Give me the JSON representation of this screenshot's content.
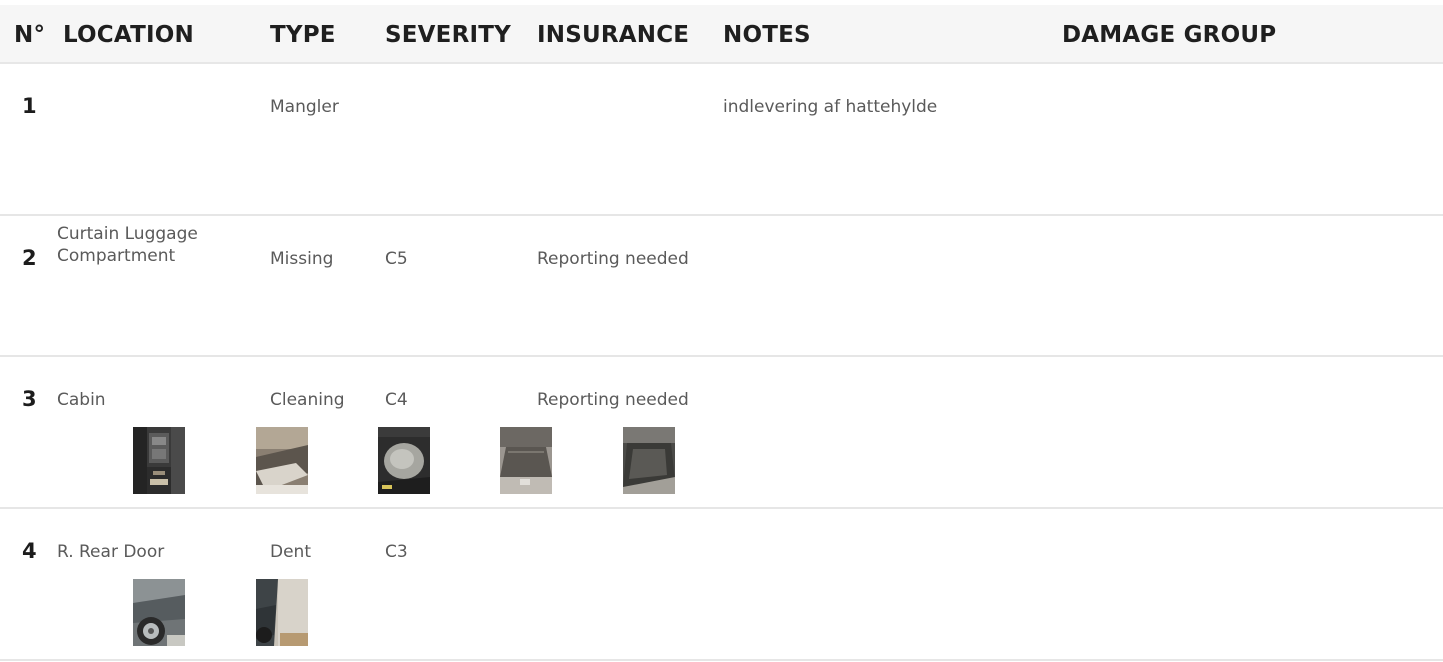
{
  "header": {
    "num": "N°",
    "location": "LOCATION",
    "type": "TYPE",
    "severity": "SEVERITY",
    "insurance": "INSURANCE",
    "notes": "NOTES",
    "damage_group": "DAMAGE GROUP"
  },
  "rows": [
    {
      "num": "1",
      "location": "",
      "type": "Mangler",
      "severity": "",
      "insurance": "",
      "notes": "indlevering af hattehylde",
      "photos": []
    },
    {
      "num": "2",
      "location": "Curtain Luggage Compartment",
      "type": "Missing",
      "severity": "C5",
      "insurance": "Reporting needed",
      "notes": "",
      "photos": []
    },
    {
      "num": "3",
      "location": "Cabin",
      "type": "Cleaning",
      "severity": "C4",
      "insurance": "Reporting needed",
      "notes": "",
      "photos": [
        "photo-center-console",
        "photo-door-sill",
        "photo-footwell",
        "photo-trunk",
        "photo-floor-mat"
      ]
    },
    {
      "num": "4",
      "location": "R. Rear Door",
      "type": "Dent",
      "severity": "C3",
      "insurance": "",
      "notes": "",
      "photos": [
        "photo-rear-wheel",
        "photo-door-panel"
      ]
    }
  ]
}
